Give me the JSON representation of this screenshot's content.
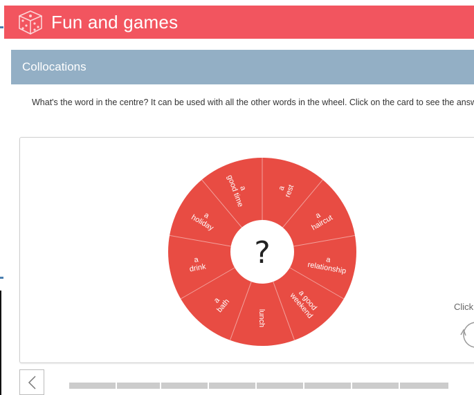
{
  "header": {
    "title": "Fun and games",
    "icon": "dice-icon",
    "color": "#f2555f"
  },
  "section": {
    "title": "Collocations",
    "color": "#93afc5"
  },
  "instructions": "What's the word in the centre? It can be used with all the other words in the wheel. Click on the card to see the answer.",
  "wheel": {
    "center_label": "?",
    "color": "#e84c43",
    "segments": [
      [
        "a",
        "rest"
      ],
      [
        "a",
        "haircut"
      ],
      [
        "a",
        "relationship"
      ],
      [
        "a good",
        "weekend"
      ],
      [
        "lunch"
      ],
      [
        "a",
        "bath"
      ],
      [
        "a",
        "drink"
      ],
      [
        "a",
        "holiday"
      ],
      [
        "a",
        "good time"
      ]
    ]
  },
  "hint": {
    "text": "Click",
    "icon": "rotate-icon"
  },
  "navigation": {
    "prev_icon": "chevron-left-icon",
    "progress_segments": 8
  }
}
